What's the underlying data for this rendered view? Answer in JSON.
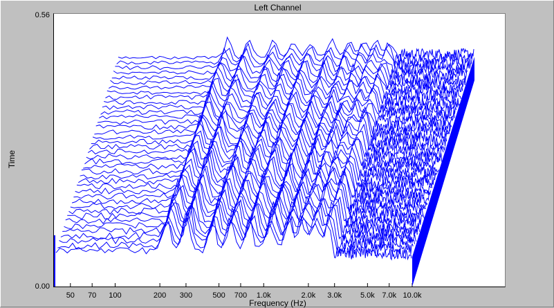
{
  "chart_data": {
    "type": "line",
    "title": "Left Channel",
    "xlabel": "Frequency (Hz)",
    "ylabel": "Time",
    "y_ticks": [
      "0.56",
      "0.00"
    ],
    "ylim": [
      0,
      0.56
    ],
    "x_scale": "log",
    "x_ticks": [
      "50",
      "70",
      "100",
      "200",
      "300",
      "500",
      "700",
      "1.0k",
      "2.0k",
      "3.0k",
      "5.0k",
      "7.0k",
      "10.0k"
    ],
    "x_tick_values": [
      50,
      70,
      100,
      200,
      300,
      500,
      700,
      1000,
      2000,
      3000,
      5000,
      7000,
      10000
    ],
    "series_color": "#0000ff",
    "slice_count": 40,
    "spectral_peaks_hz": [
      220,
      300,
      450,
      600,
      800,
      1100,
      1450,
      1800,
      2200,
      2700
    ]
  }
}
